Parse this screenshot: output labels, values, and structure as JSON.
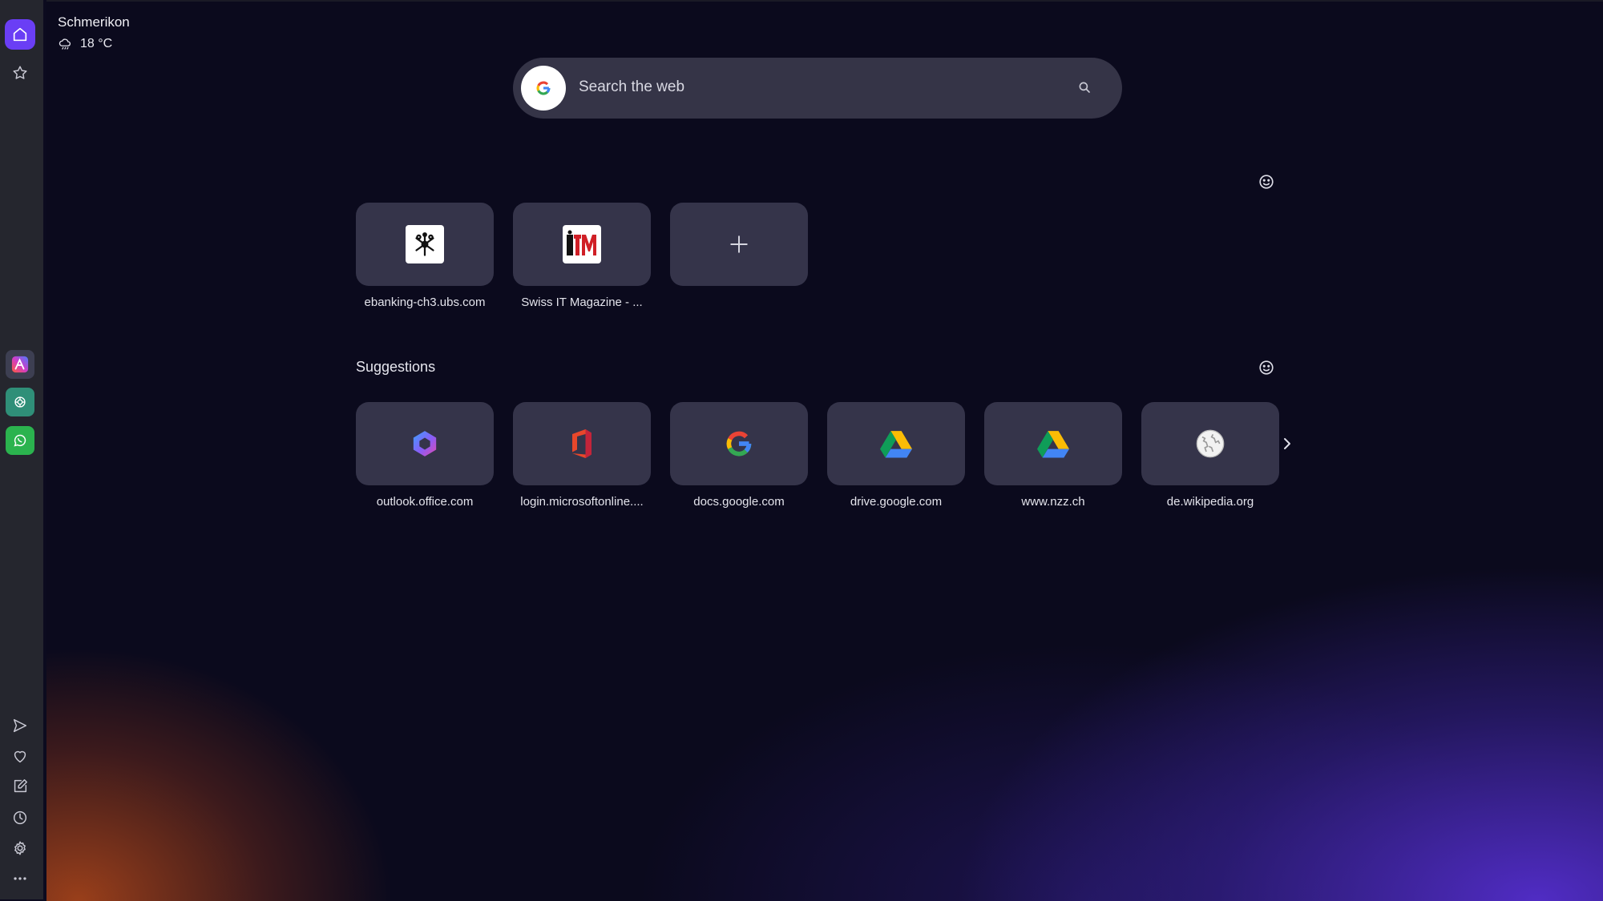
{
  "weather": {
    "city": "Schmerikon",
    "temperature": "18 °C",
    "icon": "cloud-rain-icon"
  },
  "search": {
    "placeholder": "Search the web",
    "engine_icon": "google-logo-icon"
  },
  "speed_dial": {
    "tiles": [
      {
        "label": "ebanking-ch3.ubs.com",
        "icon": "ubs-logo-icon"
      },
      {
        "label": "Swiss IT Magazine - ...",
        "icon": "itm-logo-icon"
      },
      {
        "label": "",
        "icon": "plus-icon"
      }
    ]
  },
  "suggestions": {
    "title": "Suggestions",
    "tiles": [
      {
        "label": "outlook.office.com",
        "icon": "copilot-logo-icon"
      },
      {
        "label": "login.microsoftonline....",
        "icon": "office-logo-icon"
      },
      {
        "label": "docs.google.com",
        "icon": "google-logo-icon"
      },
      {
        "label": "drive.google.com",
        "icon": "google-drive-logo-icon"
      },
      {
        "label": "www.nzz.ch",
        "icon": "google-drive-logo-icon"
      },
      {
        "label": "de.wikipedia.org",
        "icon": "wikipedia-logo-icon"
      }
    ]
  },
  "colors": {
    "accent": "#6a3ef5",
    "sidebar": "#25262e",
    "tile": "#35344a",
    "search_bar": "#353447"
  }
}
